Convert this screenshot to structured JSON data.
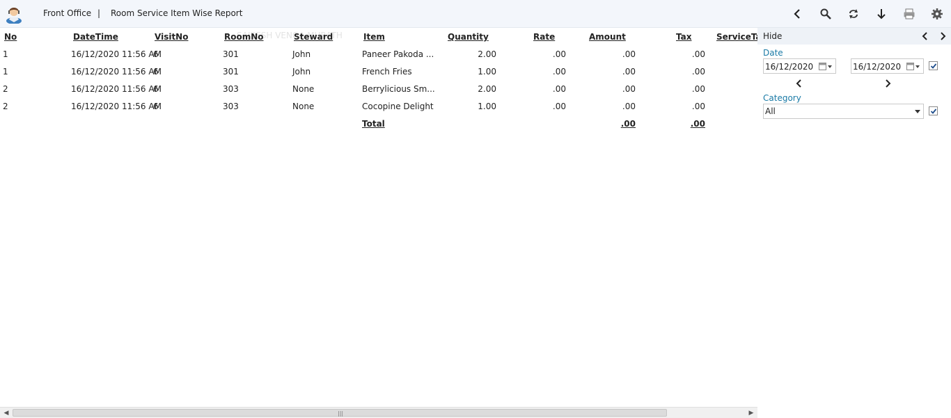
{
  "header": {
    "app_title": "Front Office",
    "separator": "|",
    "report_title": "Room Service Item Wise Report"
  },
  "toolbar": {
    "icons": [
      "back-icon",
      "search-icon",
      "refresh-icon",
      "download-icon",
      "print-icon",
      "settings-icon"
    ]
  },
  "watermark": "SAJEESH VENGA MURATH",
  "table": {
    "columns": [
      "No",
      "DateTime",
      "VisitNo",
      "RoomNo",
      "Steward",
      "Item",
      "Quantity",
      "Rate",
      "Amount",
      "Tax",
      "ServiceTax"
    ],
    "rows": [
      {
        "no": "1",
        "datetime": "16/12/2020 11:56 AM",
        "visitno": "6",
        "roomno": "301",
        "steward": "John",
        "item": "Paneer Pakoda ...",
        "quantity": "2.00",
        "rate": ".00",
        "amount": ".00",
        "tax": ".00"
      },
      {
        "no": "1",
        "datetime": "16/12/2020 11:56 AM",
        "visitno": "6",
        "roomno": "301",
        "steward": "John",
        "item": "French Fries",
        "quantity": "1.00",
        "rate": ".00",
        "amount": ".00",
        "tax": ".00"
      },
      {
        "no": "2",
        "datetime": "16/12/2020 11:56 AM",
        "visitno": "6",
        "roomno": "303",
        "steward": "None",
        "item": "Berrylicious Sm...",
        "quantity": "2.00",
        "rate": ".00",
        "amount": ".00",
        "tax": ".00"
      },
      {
        "no": "2",
        "datetime": "16/12/2020 11:56 AM",
        "visitno": "6",
        "roomno": "303",
        "steward": "None",
        "item": "Cocopine Delight",
        "quantity": "1.00",
        "rate": ".00",
        "amount": ".00",
        "tax": ".00"
      }
    ],
    "total": {
      "label": "Total",
      "amount": ".00",
      "tax": ".00"
    }
  },
  "panel": {
    "hide_label": "Hide",
    "date_label": "Date",
    "date_from": "16/12/2020",
    "date_to": "16/12/2020",
    "category_label": "Category",
    "category_value": "All"
  },
  "colors": {
    "accent": "#1a7aa6",
    "toolbar_bg": "#f3f6fb"
  }
}
